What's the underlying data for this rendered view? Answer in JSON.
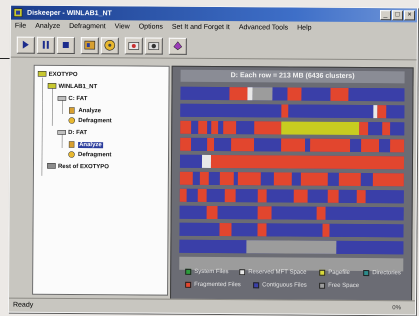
{
  "window": {
    "title": "Diskeeper - WINLAB1_NT",
    "controls": [
      "_",
      "□",
      "×"
    ]
  },
  "menu": [
    "File",
    "Analyze",
    "Defragment",
    "View",
    "Options",
    "Set It and Forget It",
    "Advanced Tools",
    "Help"
  ],
  "toolbar": {
    "buttons": [
      "play-icon",
      "pause-icon",
      "stop-icon",
      "analyze-icon",
      "defragment-icon",
      "options-icon",
      "schedule-icon",
      "help-icon"
    ]
  },
  "tree": {
    "items": [
      {
        "label": "EXOTYPO",
        "level": 0,
        "icon": "computer-icon"
      },
      {
        "label": "WINLAB1_NT",
        "level": 1,
        "icon": "computer-icon"
      },
      {
        "label": "C: FAT",
        "level": 2,
        "icon": "drive-icon"
      },
      {
        "label": "Analyze",
        "level": 3,
        "icon": "analyze-icon"
      },
      {
        "label": "Defragment",
        "level": 3,
        "icon": "defragment-icon"
      },
      {
        "label": "D: FAT",
        "level": 2,
        "icon": "drive-icon"
      },
      {
        "label": "Analyze",
        "level": 3,
        "icon": "analyze-icon",
        "selected": true
      },
      {
        "label": "Defragment",
        "level": 3,
        "icon": "defragment-icon"
      },
      {
        "label": "Rest of EXOTYPO",
        "level": 1,
        "icon": "network-icon"
      }
    ]
  },
  "map": {
    "header": "D:  Each row = 213 MB (6436 clusters)",
    "colors": {
      "contiguous": "#3a3fa8",
      "fragmented": "#e2462e",
      "system": "#2c9c3c",
      "reserved": "#d8d83a",
      "pagefile": "#c8cc20",
      "directories": "#2c8c8c",
      "free": "#9c9c9c",
      "white": "#e8e8e8"
    },
    "legend": [
      {
        "label": "System Files",
        "color": "#2c9c3c"
      },
      {
        "label": "Reserved MFT Space",
        "color": "#e8e8e8"
      },
      {
        "label": "Pagefile",
        "color": "#d8d83a"
      },
      {
        "label": "Directories",
        "color": "#2c8c8c"
      },
      {
        "label": "Fragmented Files",
        "color": "#e2462e"
      },
      {
        "label": "Contiguous Files",
        "color": "#3a3fa8"
      },
      {
        "label": "Free Space",
        "color": "#9c9c9c"
      }
    ],
    "rows": [
      [
        [
          "c",
          0.22
        ],
        [
          "f",
          0.08
        ],
        [
          "w",
          0.02
        ],
        [
          "g",
          0.09
        ],
        [
          "c",
          0.07
        ],
        [
          "f",
          0.06
        ],
        [
          "c",
          0.13
        ],
        [
          "f",
          0.08
        ],
        [
          "c",
          0.25
        ]
      ],
      [
        [
          "c",
          0.45
        ],
        [
          "f",
          0.03
        ],
        [
          "c",
          0.38
        ],
        [
          "w",
          0.02
        ],
        [
          "f",
          0.04
        ],
        [
          "c",
          0.08
        ]
      ],
      [
        [
          "f",
          0.05
        ],
        [
          "c",
          0.03
        ],
        [
          "f",
          0.04
        ],
        [
          "c",
          0.02
        ],
        [
          "f",
          0.03
        ],
        [
          "c",
          0.02
        ],
        [
          "f",
          0.06
        ],
        [
          "c",
          0.08
        ],
        [
          "f",
          0.12
        ],
        [
          "y",
          0.35
        ],
        [
          "f",
          0.04
        ],
        [
          "c",
          0.06
        ],
        [
          "f",
          0.04
        ],
        [
          "c",
          0.06
        ]
      ],
      [
        [
          "f",
          0.05
        ],
        [
          "c",
          0.07
        ],
        [
          "f",
          0.03
        ],
        [
          "c",
          0.08
        ],
        [
          "f",
          0.1
        ],
        [
          "c",
          0.12
        ],
        [
          "f",
          0.11
        ],
        [
          "c",
          0.02
        ],
        [
          "f",
          0.18
        ],
        [
          "c",
          0.05
        ],
        [
          "f",
          0.08
        ],
        [
          "c",
          0.05
        ],
        [
          "f",
          0.06
        ]
      ],
      [
        [
          "c",
          0.1
        ],
        [
          "w",
          0.04
        ],
        [
          "f",
          0.86
        ]
      ],
      [
        [
          "f",
          0.06
        ],
        [
          "c",
          0.03
        ],
        [
          "f",
          0.04
        ],
        [
          "c",
          0.05
        ],
        [
          "f",
          0.06
        ],
        [
          "c",
          0.02
        ],
        [
          "f",
          0.1
        ],
        [
          "c",
          0.06
        ],
        [
          "f",
          0.08
        ],
        [
          "c",
          0.04
        ],
        [
          "f",
          0.12
        ],
        [
          "c",
          0.05
        ],
        [
          "f",
          0.1
        ],
        [
          "c",
          0.05
        ],
        [
          "f",
          0.14
        ]
      ],
      [
        [
          "f",
          0.03
        ],
        [
          "c",
          0.05
        ],
        [
          "f",
          0.04
        ],
        [
          "c",
          0.08
        ],
        [
          "f",
          0.05
        ],
        [
          "c",
          0.1
        ],
        [
          "f",
          0.04
        ],
        [
          "c",
          0.12
        ],
        [
          "f",
          0.06
        ],
        [
          "c",
          0.09
        ],
        [
          "f",
          0.05
        ],
        [
          "c",
          0.08
        ],
        [
          "f",
          0.04
        ],
        [
          "c",
          0.17
        ]
      ],
      [
        [
          "c",
          0.12
        ],
        [
          "f",
          0.05
        ],
        [
          "c",
          0.18
        ],
        [
          "f",
          0.06
        ],
        [
          "c",
          0.2
        ],
        [
          "f",
          0.04
        ],
        [
          "c",
          0.35
        ]
      ],
      [
        [
          "c",
          0.18
        ],
        [
          "f",
          0.05
        ],
        [
          "c",
          0.12
        ],
        [
          "f",
          0.04
        ],
        [
          "c",
          0.25
        ],
        [
          "f",
          0.03
        ],
        [
          "c",
          0.33
        ]
      ],
      [
        [
          "c",
          0.3
        ],
        [
          "v",
          0.4
        ],
        [
          "c",
          0.3
        ]
      ],
      [
        [
          "v",
          1.0
        ]
      ]
    ]
  },
  "status": {
    "text": "Ready",
    "percent": "0%"
  }
}
